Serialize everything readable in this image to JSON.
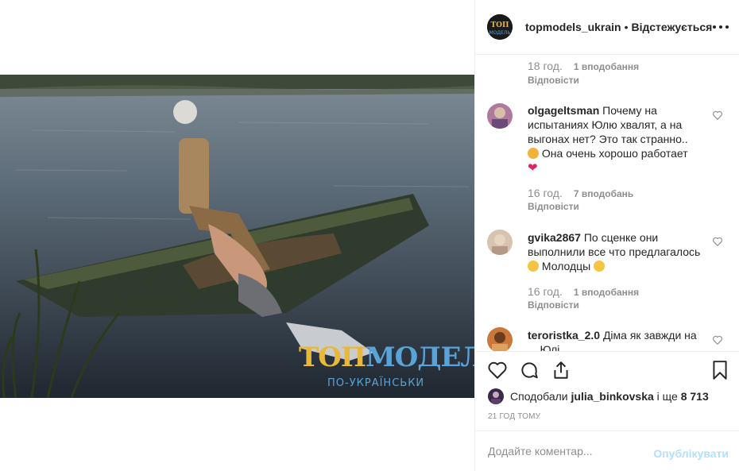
{
  "post": {
    "logo_line1_a": "ТОП",
    "logo_line1_b": "МОДЕЛЬ",
    "logo_line2": "ПО-УКРАЇНСЬКИ"
  },
  "header": {
    "username": "topmodels_ukrain",
    "separator": "•",
    "follow_label": "Відстежується",
    "avatar_icon": "topmodel-logo-avatar"
  },
  "comments": [
    {
      "time": "18 год.",
      "likes": "1 вподобання",
      "reply": "Відповісти"
    },
    {
      "username": "olgageltsman",
      "text_part1": "Почему на испытаниях Юлю хвалят, а на выгонах нет? Это так странно..",
      "emoji1": "cat-face-emoji",
      "text_part2": "Она очень хорошо работает",
      "emoji2": "red-heart-emoji",
      "time": "16 год.",
      "likes": "7 вподобань",
      "reply": "Відповісти"
    },
    {
      "username": "gvika2867",
      "text_part1": "По сценке они выполнили все что предлагалось",
      "emoji1": "ok-hand-emoji",
      "text_part2": "Молодцы",
      "emoji2": "clapping-hands-emoji",
      "time": "16 год.",
      "likes": "1 вподобання",
      "reply": "Відповісти"
    },
    {
      "username": "teroristka_2.0",
      "text": "Діма як завжди на ... Юлі ..."
    }
  ],
  "actions": {
    "like_icon": "heart-icon",
    "comment_icon": "comment-icon",
    "share_icon": "share-icon",
    "save_icon": "bookmark-icon"
  },
  "likes_line": {
    "prefix": "Сподобали",
    "user": "julia_binkovska",
    "middle": "і ще",
    "count": "8 713"
  },
  "timestamp": "21 ГОД ТОМУ",
  "add_comment": {
    "placeholder": "Додайте коментар...",
    "post_label": "Опублікувати"
  },
  "colors": {
    "link_disabled": "#b2dffc",
    "muted": "#8e8e8e",
    "text": "#262626",
    "logo_gold": "#e8b83a",
    "logo_blue": "#5aa3d8"
  }
}
